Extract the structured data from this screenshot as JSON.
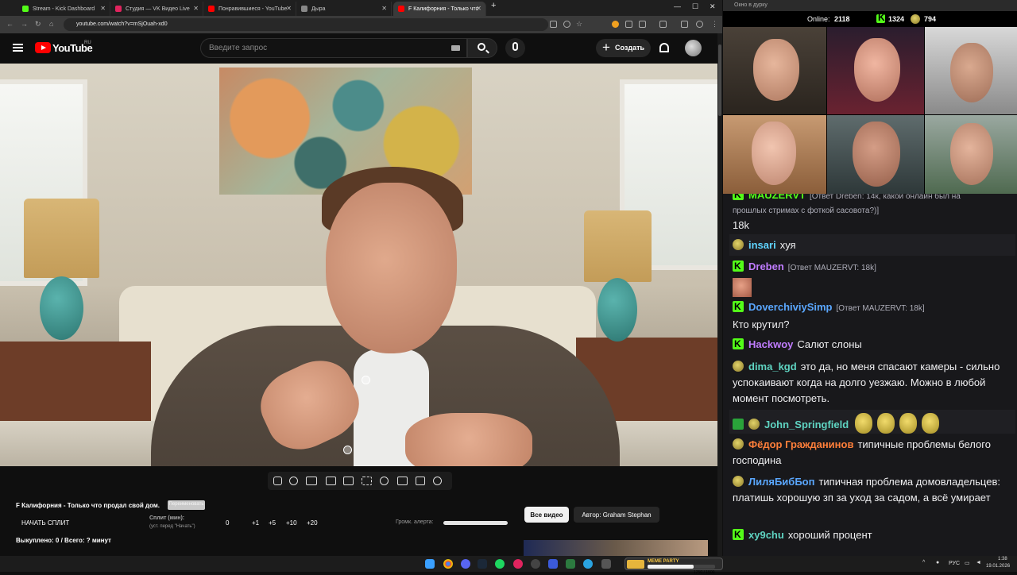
{
  "browser": {
    "tabs": [
      {
        "title": "Stream - Kick Dashboard",
        "color": "#53fc18"
      },
      {
        "title": "Студия — VK Видео Live",
        "color": "#e0245e"
      },
      {
        "title": "Понравившиеся - YouTube",
        "color": "#ff0000"
      },
      {
        "title": "Дыра",
        "color": "#888888"
      },
      {
        "title": "F Калифорния - Только что",
        "color": "#ff0000"
      }
    ],
    "url": "youtube.com/watch?v=mSjOuah-xd0"
  },
  "youtube": {
    "logo": "YouTube",
    "region": "RU",
    "search_placeholder": "Введите запрос",
    "create_label": "Создать"
  },
  "controls": {
    "video_title": "F Калифорния - Только что продал свой дом.",
    "rename_label": "Переименовать",
    "start_split": "НАЧАТЬ СПЛИТ",
    "split_label": "Сплит (мин):",
    "split_hint": "(уст. перед \"Начать\")",
    "split_value": "0",
    "increments": [
      "+1",
      "+5",
      "+10",
      "+20"
    ],
    "alert_volume_label": "Громк. алерта:",
    "alert_volume": 0.95,
    "bought": "Выкуплено: 0 / Всего: ? минут",
    "all_videos": "Все видео",
    "author": "Автор: Graham Stephan"
  },
  "panel": {
    "title": "Окно в дурку",
    "online_label": "Online:",
    "online": "2118",
    "kick_count": "1324",
    "coin_count": "794"
  },
  "chat": [
    {
      "user": "MAUZERVT",
      "reply": "[Ответ Dreben: 14к, какой онлайн был на",
      "text": "прошлых стримах с фоткой сасовота?)]",
      "extra": "18k",
      "color": "#53fc18"
    },
    {
      "user": "insari",
      "text": "хуя",
      "color": "#5fd4ff"
    },
    {
      "user": "Dreben",
      "reply": "[Ответ MAUZERVT: 18k]",
      "text": "",
      "color": "#c07cff"
    },
    {
      "user": "DoverchiviySimp",
      "reply": "[Ответ MAUZERVT: 18k]",
      "text": "Кто крутил?",
      "color": "#5aa7ff"
    },
    {
      "user": "Hackwoy",
      "text": "Салют слоны",
      "color": "#c07cff"
    },
    {
      "user": "dima_kgd",
      "text": "это да, но меня спасают камеры - сильно успокаивают когда на долго уезжаю. Можно в любой момент посмотреть.",
      "color": "#5fd4c2"
    },
    {
      "user": "John_Springfield",
      "text": "",
      "color": "#5fd4c2"
    },
    {
      "user": "Фёдор Гражданинов",
      "text": "типичные проблемы белого господина",
      "color": "#ff7f3a"
    },
    {
      "user": "ЛиляБибБоп",
      "text": "типичная проблема домовладельцев: платишь хорошую зп за уход за садом, а всё умирает",
      "color": "#5aa7ff"
    },
    {
      "user": "xy9chu",
      "text": "хороший процент",
      "color": "#5fd4c2"
    }
  ],
  "taskbar": {
    "meme_party": "MEME PARTY",
    "meme_value": "1250 / 1500",
    "lang": "РУС",
    "time": "1:38",
    "date": "19.01.2026"
  }
}
